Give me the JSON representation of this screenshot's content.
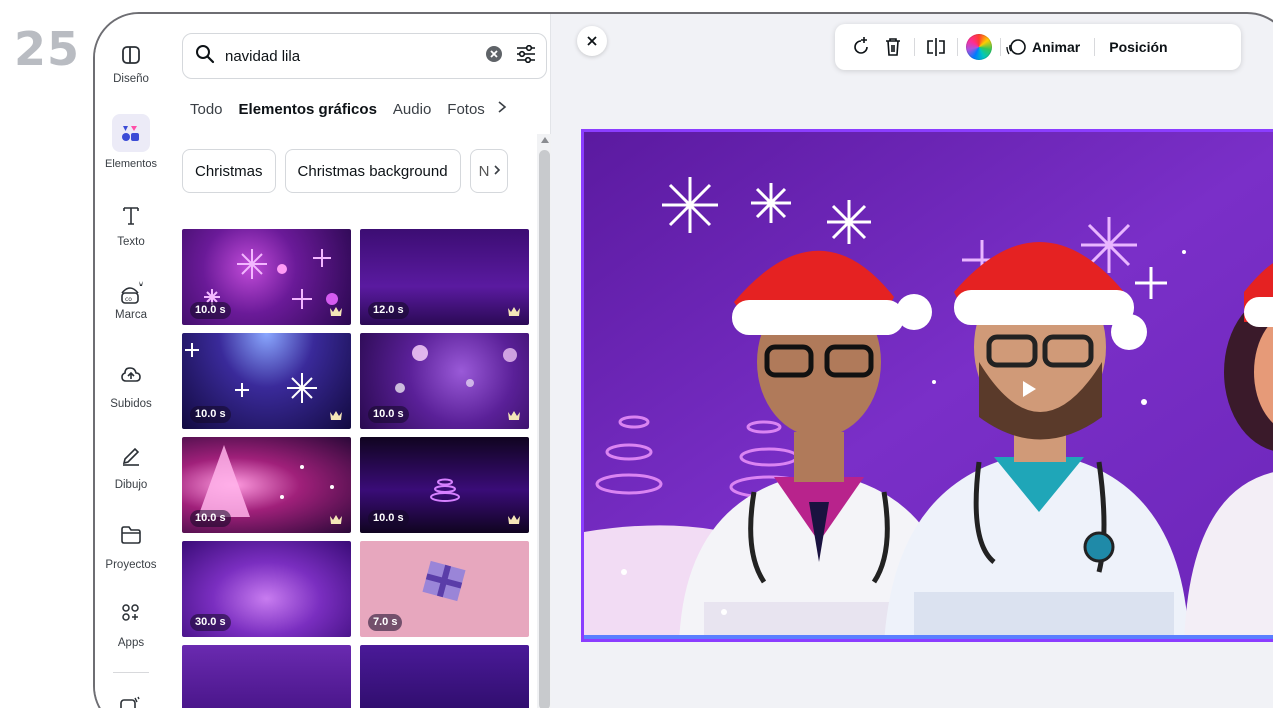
{
  "step_number": "25",
  "rail": {
    "items": [
      {
        "label": "Diseño",
        "icon": "layout-icon"
      },
      {
        "label": "Elementos",
        "icon": "shapes-icon"
      },
      {
        "label": "Texto",
        "icon": "text-icon"
      },
      {
        "label": "Marca",
        "icon": "brand-icon"
      },
      {
        "label": "Subidos",
        "icon": "cloud-upload-icon"
      },
      {
        "label": "Dibujo",
        "icon": "pen-icon"
      },
      {
        "label": "Proyectos",
        "icon": "folder-icon"
      },
      {
        "label": "Apps",
        "icon": "apps-icon"
      }
    ]
  },
  "search": {
    "value": "navidad lila"
  },
  "tabs": [
    "Todo",
    "Elementos gráficos",
    "Audio",
    "Fotos"
  ],
  "chips": [
    "Christmas",
    "Christmas background",
    "N"
  ],
  "results": [
    {
      "duration": "10.0 s"
    },
    {
      "duration": "12.0 s"
    },
    {
      "duration": "10.0 s"
    },
    {
      "duration": "10.0 s"
    },
    {
      "duration": "10.0 s"
    },
    {
      "duration": "10.0 s"
    },
    {
      "duration": "30.0 s"
    },
    {
      "duration": "7.0 s"
    },
    {
      "duration": ""
    },
    {
      "duration": ""
    }
  ],
  "toolbar": {
    "animate_label": "Animar",
    "position_label": "Posición"
  },
  "colors": {
    "accent": "#8b3dff",
    "video_bg": "#6a22b0"
  }
}
